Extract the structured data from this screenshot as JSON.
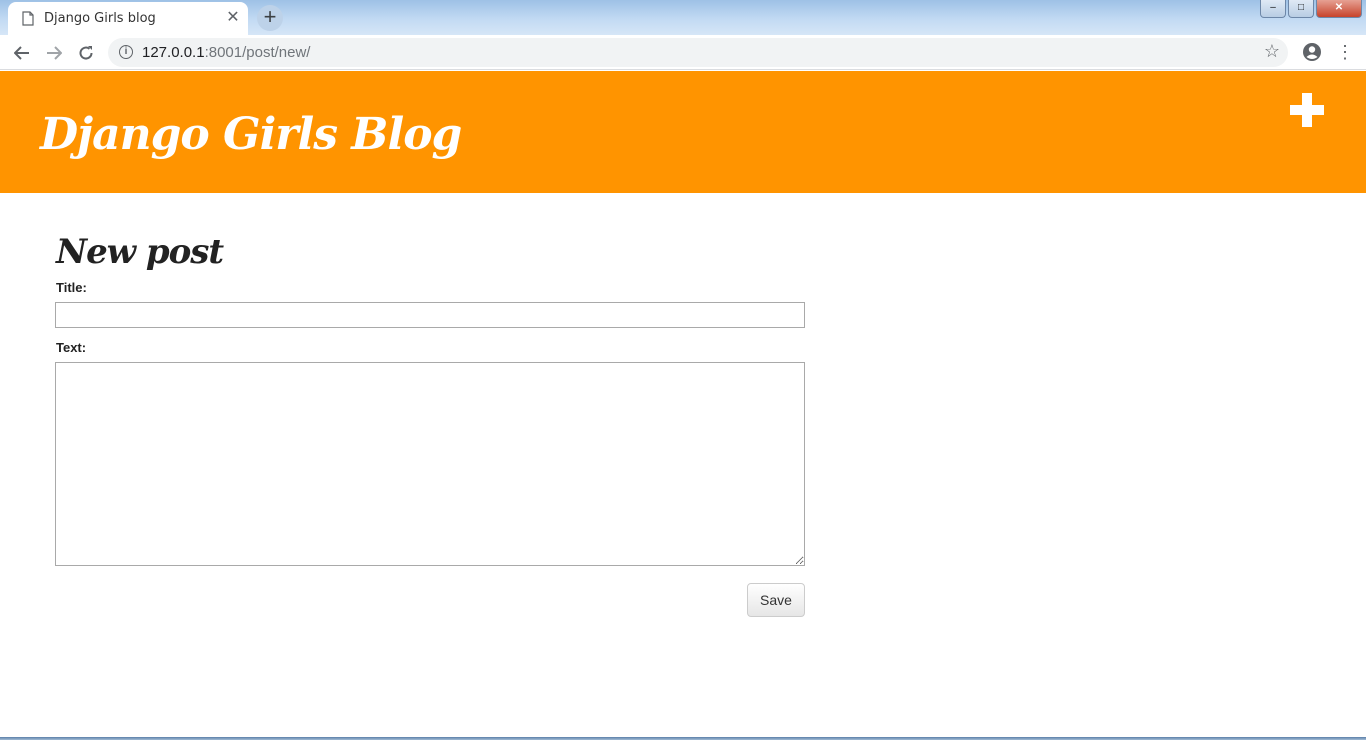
{
  "browser": {
    "tab_title": "Django Girls blog",
    "tab_close_glyph": "✕",
    "new_tab_glyph": "+",
    "url_host": "127.0.0.1",
    "url_rest": ":8001/post/new/",
    "window_controls": {
      "minimize": "–",
      "maximize": "□",
      "close": "✕"
    },
    "icons": [
      "page-icon",
      "back-arrow-icon",
      "forward-arrow-icon",
      "reload-icon",
      "info-icon",
      "star-icon",
      "account-icon",
      "kebab-menu-icon"
    ]
  },
  "header": {
    "site_title": "Django Girls Blog",
    "background_color": "#ff9400",
    "add_icon": "plus-icon"
  },
  "form": {
    "heading": "New post",
    "title_label": "Title:",
    "title_value": "",
    "text_label": "Text:",
    "text_value": "",
    "save_label": "Save"
  }
}
